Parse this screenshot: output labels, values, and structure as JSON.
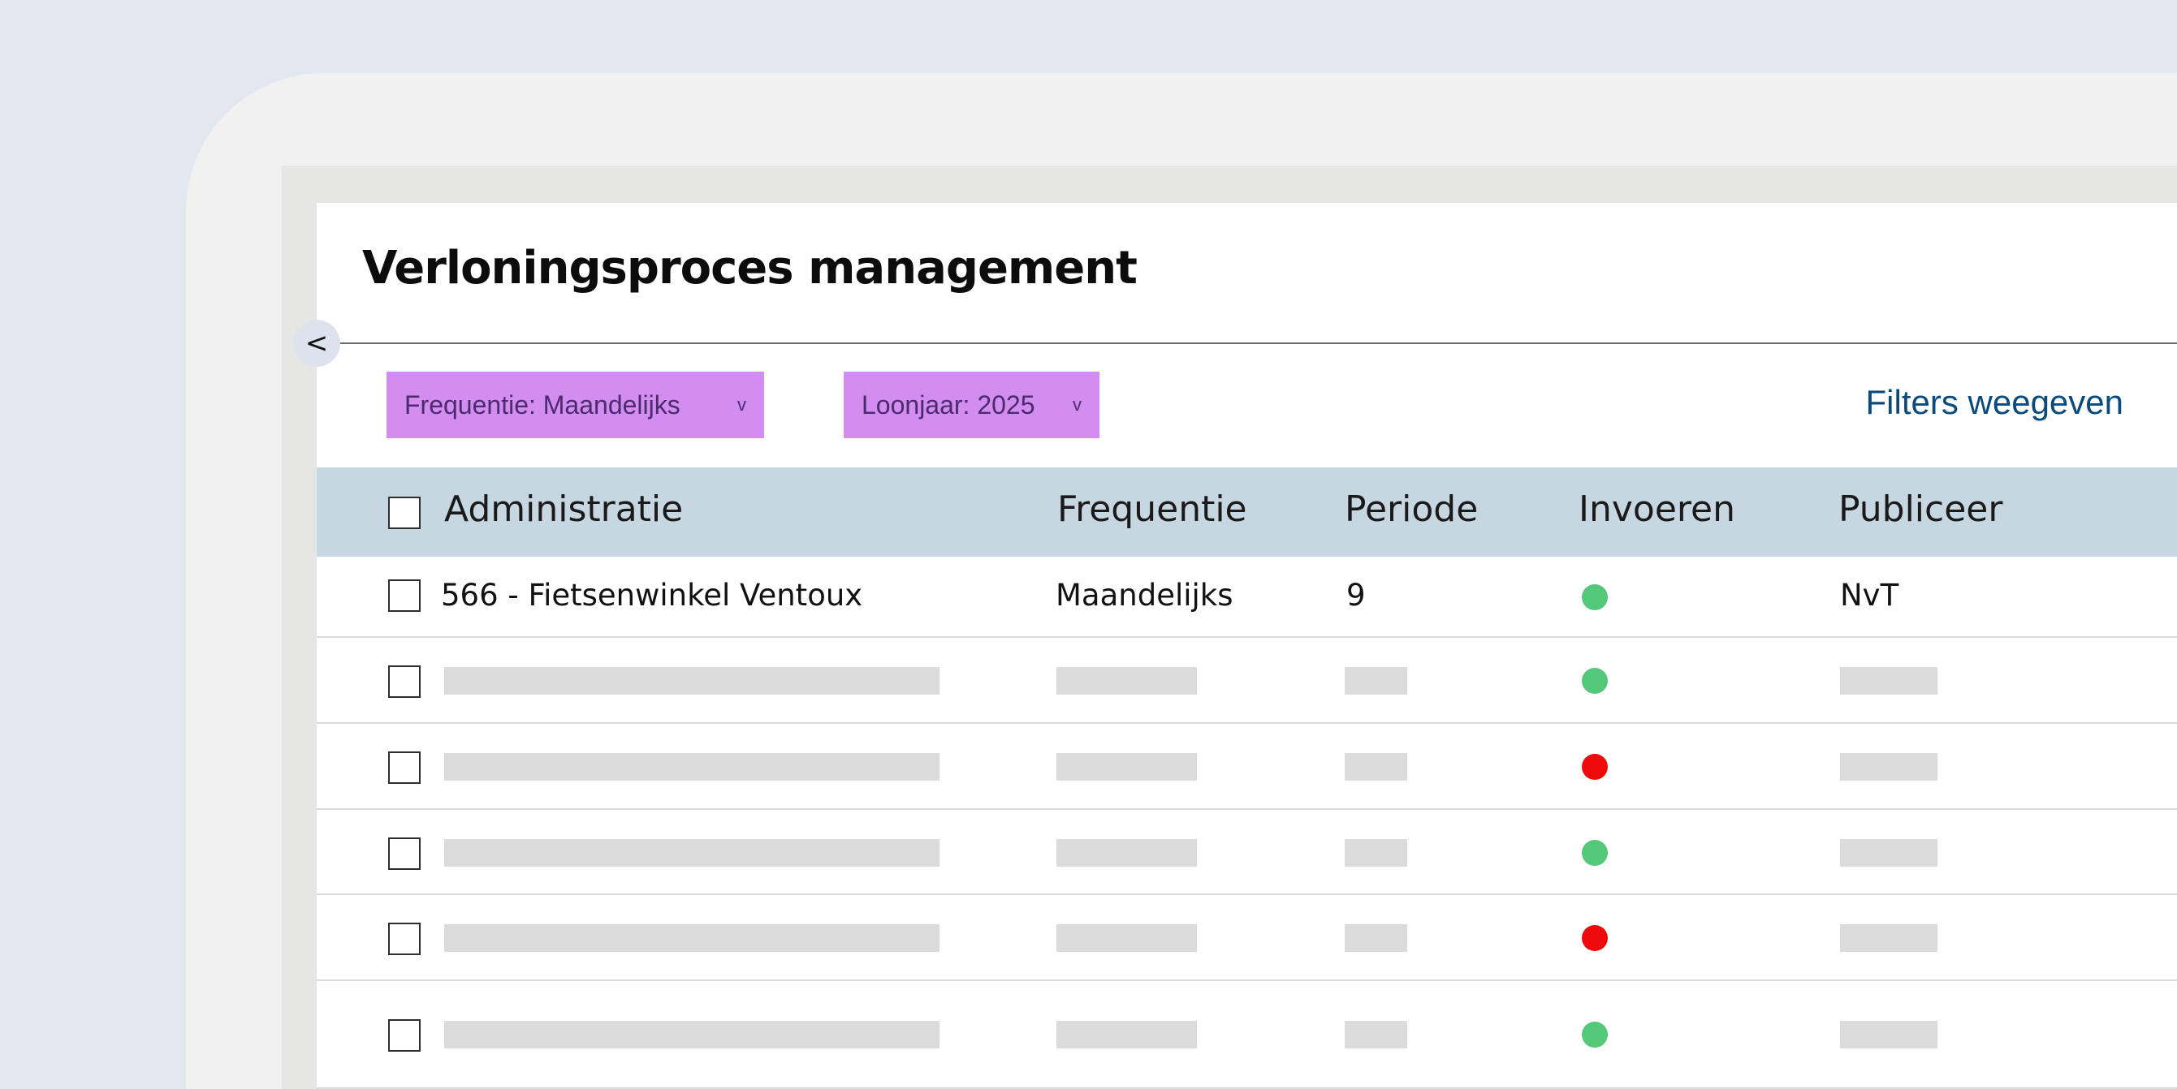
{
  "page": {
    "title": "Verloningsproces management"
  },
  "sidebar_toggle": {
    "glyph": "<"
  },
  "filters": {
    "chips": [
      {
        "label": "Frequentie: Maandelijks",
        "chevron": "v"
      },
      {
        "label": "Loonjaar: 2025",
        "chevron": "v"
      }
    ],
    "toggle_link": "Filters weegeven"
  },
  "table": {
    "columns": [
      "Administratie",
      "Frequentie",
      "Periode",
      "Invoeren",
      "Publiceer"
    ],
    "first_row": {
      "administratie": "566 - Fietsenwinkel Ventoux",
      "frequentie": "Maandelijks",
      "periode": "9",
      "invoeren_status": "green",
      "publiceer": "NvT"
    },
    "placeholder_row_statuses": [
      "green",
      "red",
      "green",
      "red",
      "green"
    ]
  },
  "colors": {
    "status_green": "#53c878",
    "status_red": "#ee0a0a",
    "chip_background": "#d38df0",
    "header_background": "#c7d7e1",
    "link": "#0a4a7d"
  },
  "icons": {
    "collapse": "chevron-left-icon",
    "chip_dropdown": "chevron-down-icon",
    "status": "status-dot-icon"
  }
}
